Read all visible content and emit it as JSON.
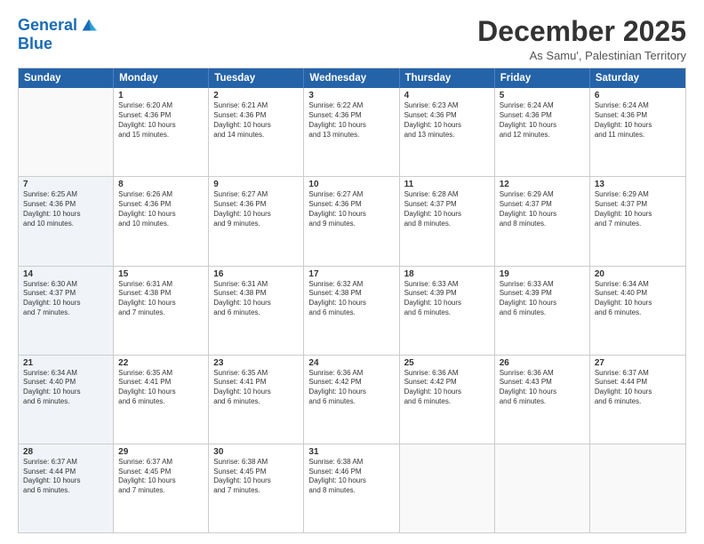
{
  "logo": {
    "line1": "General",
    "line2": "Blue"
  },
  "title": "December 2025",
  "subtitle": "As Samu', Palestinian Territory",
  "headers": [
    "Sunday",
    "Monday",
    "Tuesday",
    "Wednesday",
    "Thursday",
    "Friday",
    "Saturday"
  ],
  "rows": [
    [
      {
        "day": "",
        "text": "",
        "empty": true
      },
      {
        "day": "1",
        "text": "Sunrise: 6:20 AM\nSunset: 4:36 PM\nDaylight: 10 hours\nand 15 minutes."
      },
      {
        "day": "2",
        "text": "Sunrise: 6:21 AM\nSunset: 4:36 PM\nDaylight: 10 hours\nand 14 minutes."
      },
      {
        "day": "3",
        "text": "Sunrise: 6:22 AM\nSunset: 4:36 PM\nDaylight: 10 hours\nand 13 minutes."
      },
      {
        "day": "4",
        "text": "Sunrise: 6:23 AM\nSunset: 4:36 PM\nDaylight: 10 hours\nand 13 minutes."
      },
      {
        "day": "5",
        "text": "Sunrise: 6:24 AM\nSunset: 4:36 PM\nDaylight: 10 hours\nand 12 minutes."
      },
      {
        "day": "6",
        "text": "Sunrise: 6:24 AM\nSunset: 4:36 PM\nDaylight: 10 hours\nand 11 minutes."
      }
    ],
    [
      {
        "day": "7",
        "text": "Sunrise: 6:25 AM\nSunset: 4:36 PM\nDaylight: 10 hours\nand 10 minutes.",
        "shaded": true
      },
      {
        "day": "8",
        "text": "Sunrise: 6:26 AM\nSunset: 4:36 PM\nDaylight: 10 hours\nand 10 minutes."
      },
      {
        "day": "9",
        "text": "Sunrise: 6:27 AM\nSunset: 4:36 PM\nDaylight: 10 hours\nand 9 minutes."
      },
      {
        "day": "10",
        "text": "Sunrise: 6:27 AM\nSunset: 4:36 PM\nDaylight: 10 hours\nand 9 minutes."
      },
      {
        "day": "11",
        "text": "Sunrise: 6:28 AM\nSunset: 4:37 PM\nDaylight: 10 hours\nand 8 minutes."
      },
      {
        "day": "12",
        "text": "Sunrise: 6:29 AM\nSunset: 4:37 PM\nDaylight: 10 hours\nand 8 minutes."
      },
      {
        "day": "13",
        "text": "Sunrise: 6:29 AM\nSunset: 4:37 PM\nDaylight: 10 hours\nand 7 minutes."
      }
    ],
    [
      {
        "day": "14",
        "text": "Sunrise: 6:30 AM\nSunset: 4:37 PM\nDaylight: 10 hours\nand 7 minutes.",
        "shaded": true
      },
      {
        "day": "15",
        "text": "Sunrise: 6:31 AM\nSunset: 4:38 PM\nDaylight: 10 hours\nand 7 minutes."
      },
      {
        "day": "16",
        "text": "Sunrise: 6:31 AM\nSunset: 4:38 PM\nDaylight: 10 hours\nand 6 minutes."
      },
      {
        "day": "17",
        "text": "Sunrise: 6:32 AM\nSunset: 4:38 PM\nDaylight: 10 hours\nand 6 minutes."
      },
      {
        "day": "18",
        "text": "Sunrise: 6:33 AM\nSunset: 4:39 PM\nDaylight: 10 hours\nand 6 minutes."
      },
      {
        "day": "19",
        "text": "Sunrise: 6:33 AM\nSunset: 4:39 PM\nDaylight: 10 hours\nand 6 minutes."
      },
      {
        "day": "20",
        "text": "Sunrise: 6:34 AM\nSunset: 4:40 PM\nDaylight: 10 hours\nand 6 minutes."
      }
    ],
    [
      {
        "day": "21",
        "text": "Sunrise: 6:34 AM\nSunset: 4:40 PM\nDaylight: 10 hours\nand 6 minutes.",
        "shaded": true
      },
      {
        "day": "22",
        "text": "Sunrise: 6:35 AM\nSunset: 4:41 PM\nDaylight: 10 hours\nand 6 minutes."
      },
      {
        "day": "23",
        "text": "Sunrise: 6:35 AM\nSunset: 4:41 PM\nDaylight: 10 hours\nand 6 minutes."
      },
      {
        "day": "24",
        "text": "Sunrise: 6:36 AM\nSunset: 4:42 PM\nDaylight: 10 hours\nand 6 minutes."
      },
      {
        "day": "25",
        "text": "Sunrise: 6:36 AM\nSunset: 4:42 PM\nDaylight: 10 hours\nand 6 minutes."
      },
      {
        "day": "26",
        "text": "Sunrise: 6:36 AM\nSunset: 4:43 PM\nDaylight: 10 hours\nand 6 minutes."
      },
      {
        "day": "27",
        "text": "Sunrise: 6:37 AM\nSunset: 4:44 PM\nDaylight: 10 hours\nand 6 minutes."
      }
    ],
    [
      {
        "day": "28",
        "text": "Sunrise: 6:37 AM\nSunset: 4:44 PM\nDaylight: 10 hours\nand 6 minutes.",
        "shaded": true
      },
      {
        "day": "29",
        "text": "Sunrise: 6:37 AM\nSunset: 4:45 PM\nDaylight: 10 hours\nand 7 minutes."
      },
      {
        "day": "30",
        "text": "Sunrise: 6:38 AM\nSunset: 4:45 PM\nDaylight: 10 hours\nand 7 minutes."
      },
      {
        "day": "31",
        "text": "Sunrise: 6:38 AM\nSunset: 4:46 PM\nDaylight: 10 hours\nand 8 minutes."
      },
      {
        "day": "",
        "text": "",
        "empty": true
      },
      {
        "day": "",
        "text": "",
        "empty": true
      },
      {
        "day": "",
        "text": "",
        "empty": true
      }
    ]
  ]
}
